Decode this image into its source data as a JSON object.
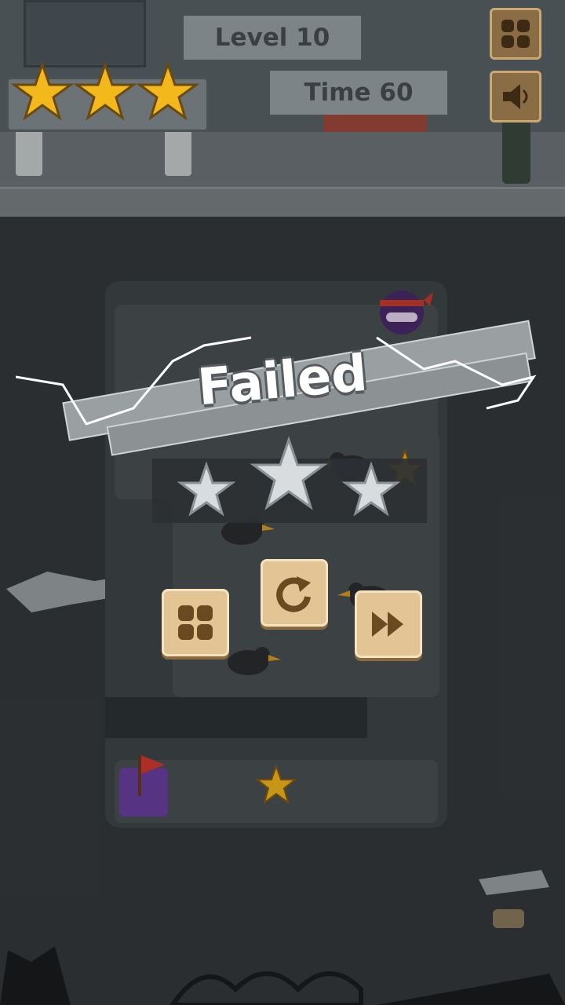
{
  "hud": {
    "level_label": "Level 10",
    "time_label": "Time 60",
    "top_stars_earned": 3
  },
  "result": {
    "title": "Failed",
    "stars_earned": 0,
    "stars_total": 3
  },
  "buttons": {
    "menu_icon": "grid-icon",
    "sound_icon": "speaker-icon",
    "levels_icon": "grid-icon",
    "retry_icon": "restart-icon",
    "skip_icon": "fast-forward-icon"
  },
  "colors": {
    "star_gold": "#f2b81c",
    "star_empty": "#d8dcde",
    "wood": "#e3c494",
    "wood_icon": "#6b4a22",
    "goal_pad": "#6a3fa0",
    "flag": "#d23a2e"
  }
}
